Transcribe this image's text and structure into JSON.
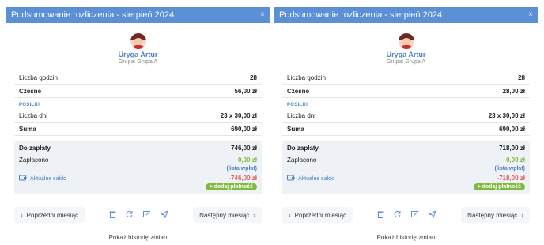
{
  "panels": [
    {
      "title": "Podsumowanie rozliczenia - sierpień 2024",
      "close_glyph": "×",
      "person": {
        "name": "Uryga Artur",
        "group": "Grupa: Grupa A"
      },
      "rows": [
        {
          "label": "Liczba godzin",
          "value": "28"
        },
        {
          "label": "Czesne",
          "value": "56,00 zł"
        }
      ],
      "section": "POSIŁKI",
      "meal_rows": [
        {
          "label": "Liczba dni",
          "value": "23 x 30,00 zł"
        },
        {
          "label": "Suma",
          "value": "690,00 zł"
        }
      ],
      "summary": {
        "due_label": "Do zapłaty",
        "due_value": "746,00 zł",
        "paid_label": "Zapłacono",
        "paid_value": "0,00 zł",
        "payments_link": "(lista wpłat)",
        "balance_label": "Aktualne saldo",
        "balance_value": "-746,00 zł",
        "add_payment": "+ dodaj płatność"
      },
      "footer": {
        "prev": "Poprzedni miesiąc",
        "next": "Następny miesiąc"
      },
      "history": "Pokaż historię zmian"
    },
    {
      "title": "Podsumowanie rozliczenia - sierpień 2024",
      "close_glyph": "×",
      "person": {
        "name": "Uryga Artur",
        "group": "Grupa: Grupa A"
      },
      "rows": [
        {
          "label": "Liczba godzin",
          "value": "28"
        },
        {
          "label": "Czesne",
          "value": "28,00 zł"
        }
      ],
      "section": "POSIŁKI",
      "meal_rows": [
        {
          "label": "Liczba dni",
          "value": "23 x 30,00 zł"
        },
        {
          "label": "Suma",
          "value": "690,00 zł"
        }
      ],
      "summary": {
        "due_label": "Do zapłaty",
        "due_value": "718,00 zł",
        "paid_label": "Zapłacono",
        "paid_value": "0,00 zł",
        "payments_link": "(lista wpłat)",
        "balance_label": "Aktualne saldo",
        "balance_value": "-718,00 zł",
        "add_payment": "+ dodaj płatność"
      },
      "footer": {
        "prev": "Poprzedni miesiąc",
        "next": "Następny miesiąc"
      },
      "history": "Pokaż historię zmian"
    }
  ],
  "icons": [
    "trash-icon",
    "refresh-icon",
    "edit-icon",
    "send-icon",
    "wallet-icon",
    "avatar"
  ],
  "colors": {
    "header": "#5b8fd6",
    "accent": "#4a7fc7",
    "paid": "#7dbb3a",
    "negative": "#e25b5b",
    "highlight": "#e04a2a"
  }
}
